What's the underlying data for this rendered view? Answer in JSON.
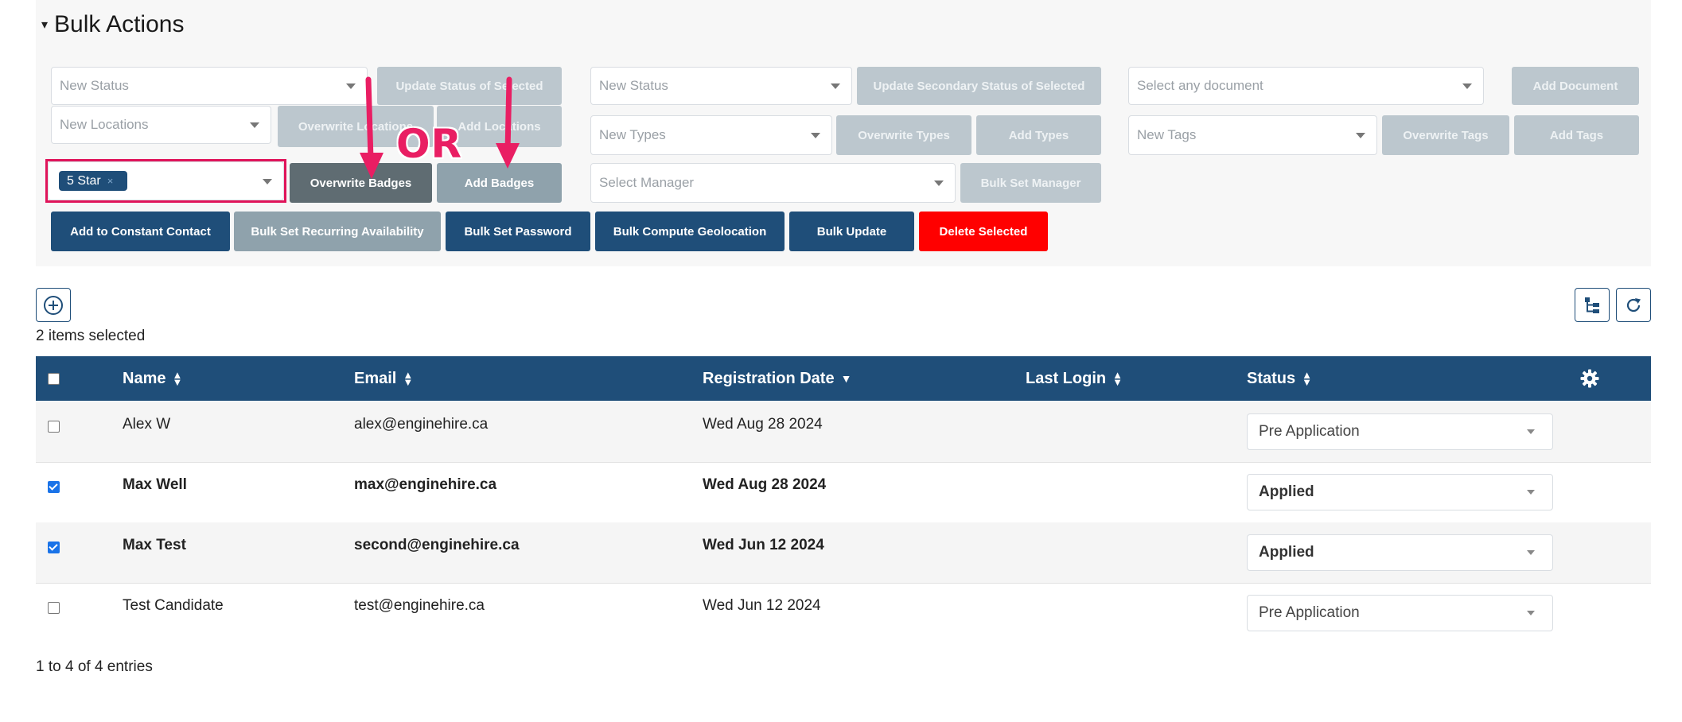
{
  "bulk_actions": {
    "title": "Bulk Actions",
    "status_select": {
      "placeholder": "New Status"
    },
    "update_status_button": "Update Status of Selected",
    "locations_select": {
      "placeholder": "New Locations"
    },
    "overwrite_locations_button": "Overwrite Locations",
    "add_locations_button": "Add Locations",
    "badges_select": {
      "selected_chip": "5 Star",
      "chip_remove": "×"
    },
    "overwrite_badges_button": "Overwrite Badges",
    "add_badges_button": "Add Badges",
    "secondary_status_select": {
      "placeholder": "New Status"
    },
    "update_secondary_status_button": "Update Secondary Status of Selected",
    "types_select": {
      "placeholder": "New Types"
    },
    "overwrite_types_button": "Overwrite Types",
    "add_types_button": "Add Types",
    "manager_select": {
      "placeholder": "Select Manager"
    },
    "bulk_set_manager_button": "Bulk Set Manager",
    "document_select": {
      "placeholder": "Select any document"
    },
    "add_document_button": "Add Document",
    "tags_select": {
      "placeholder": "New Tags"
    },
    "overwrite_tags_button": "Overwrite Tags",
    "add_tags_button": "Add Tags",
    "action_buttons": {
      "constant_contact": "Add to Constant Contact",
      "recurring_availability": "Bulk Set Recurring Availability",
      "set_password": "Bulk Set Password",
      "compute_geolocation": "Bulk Compute Geolocation",
      "bulk_update": "Bulk Update",
      "delete_selected": "Delete Selected"
    },
    "annotation_text": "OR"
  },
  "toolbar": {
    "add_icon": "plus-circle-icon",
    "hierarchy_icon": "hierarchy-icon",
    "refresh_icon": "refresh-icon"
  },
  "selected_count": "2 items selected",
  "table": {
    "columns": {
      "name": "Name",
      "email": "Email",
      "registration_date": "Registration Date",
      "last_login": "Last Login",
      "status": "Status"
    },
    "rows": [
      {
        "name": "Alex W",
        "email": "alex@enginehire.ca",
        "registration_date": "Wed Aug 28 2024",
        "last_login": "",
        "status": "Pre Application",
        "checked": false
      },
      {
        "name": "Max Well",
        "email": "max@enginehire.ca",
        "registration_date": "Wed Aug 28 2024",
        "last_login": "",
        "status": "Applied",
        "checked": true
      },
      {
        "name": "Max Test",
        "email": "second@enginehire.ca",
        "registration_date": "Wed Jun 12 2024",
        "last_login": "",
        "status": "Applied",
        "checked": true
      },
      {
        "name": "Test Candidate",
        "email": "test@enginehire.ca",
        "registration_date": "Wed Jun 12 2024",
        "last_login": "",
        "status": "Pre Application",
        "checked": false
      }
    ]
  },
  "entries_info": "1 to 4 of 4 entries",
  "colors": {
    "primary": "#1f4e79",
    "danger": "#ff0000",
    "annotation": "#e91e63"
  }
}
